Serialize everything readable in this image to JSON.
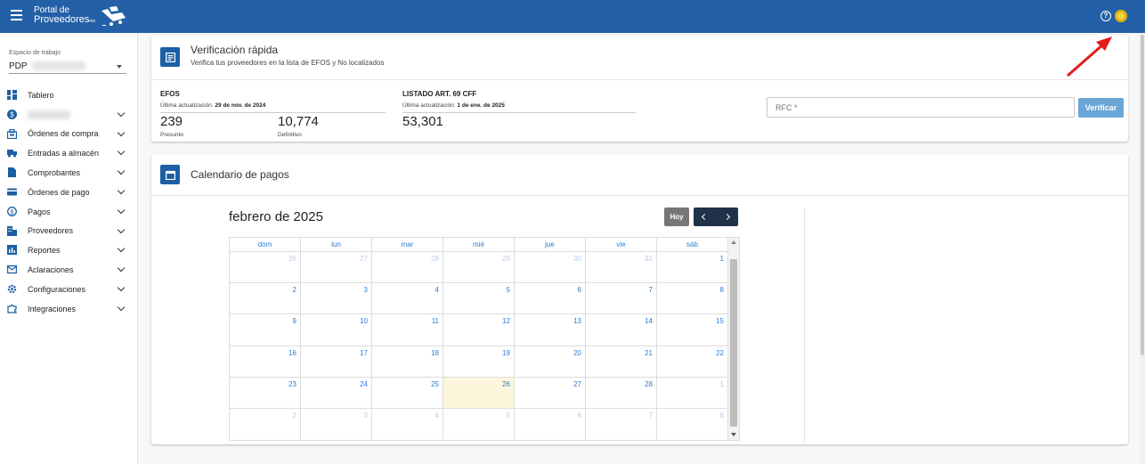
{
  "topbar": {
    "logo_line1": "Portal de",
    "logo_line2": "Proveedores",
    "logo_suffix": "mx",
    "bg_color": "#2460a7"
  },
  "sidebar": {
    "workspace_label": "Espacio de trabajo",
    "workspace_value": "PDP",
    "items": [
      {
        "label": "Tablero",
        "icon": "dashboard-icon",
        "has_chevron": false
      },
      {
        "label": "",
        "icon": "dollar-circle-icon",
        "has_chevron": true,
        "blurred": true
      },
      {
        "label": "Órdenes de compra",
        "icon": "cart-icon",
        "has_chevron": true
      },
      {
        "label": "Entradas a almacén",
        "icon": "truck-icon",
        "has_chevron": true
      },
      {
        "label": "Comprobantes",
        "icon": "document-icon",
        "has_chevron": true
      },
      {
        "label": "Órdenes de pago",
        "icon": "credit-card-icon",
        "has_chevron": true
      },
      {
        "label": "Pagos",
        "icon": "dollar-circle-icon",
        "has_chevron": true
      },
      {
        "label": "Proveedores",
        "icon": "building-icon",
        "has_chevron": true
      },
      {
        "label": "Reportes",
        "icon": "report-icon",
        "has_chevron": true
      },
      {
        "label": "Aclaraciones",
        "icon": "mail-icon",
        "has_chevron": true
      },
      {
        "label": "Configuraciones",
        "icon": "gear-icon",
        "has_chevron": true
      },
      {
        "label": "Integraciones",
        "icon": "puzzle-icon",
        "has_chevron": true
      }
    ]
  },
  "verificacion": {
    "title": "Verificación rápida",
    "subtitle": "Verifica tus proveedores en la lista de EFOS y No localizados",
    "efos": {
      "title": "EFOS",
      "update_label": "Última actualización:",
      "update_date": "29 de nov. de 2024",
      "presunto_value": "239",
      "presunto_label": "Presunto",
      "definitivo_value": "10,774",
      "definitivo_label": "Definitivo"
    },
    "listado": {
      "title": "LISTADO ART. 69 CFF",
      "update_label": "Última actualización:",
      "update_date": "1 de ene. de 2025",
      "value": "53,301"
    },
    "rfc_placeholder": "RFC *",
    "verify_label": "Verificar"
  },
  "calendario": {
    "title": "Calendario de pagos",
    "month_label": "febrero de 2025",
    "today_label": "Hoy",
    "weekdays": [
      "dom",
      "lun",
      "mar",
      "mié",
      "jue",
      "vie",
      "sáb"
    ],
    "weeks": [
      [
        "26",
        "27",
        "28",
        "29",
        "30",
        "31",
        "1"
      ],
      [
        "2",
        "3",
        "4",
        "5",
        "6",
        "7",
        "8"
      ],
      [
        "9",
        "10",
        "11",
        "12",
        "13",
        "14",
        "15"
      ],
      [
        "16",
        "17",
        "18",
        "19",
        "20",
        "21",
        "22"
      ],
      [
        "23",
        "24",
        "25",
        "26",
        "27",
        "28",
        "1"
      ],
      [
        "2",
        "3",
        "4",
        "5",
        "6",
        "7",
        "8"
      ]
    ],
    "today_day": "26"
  }
}
